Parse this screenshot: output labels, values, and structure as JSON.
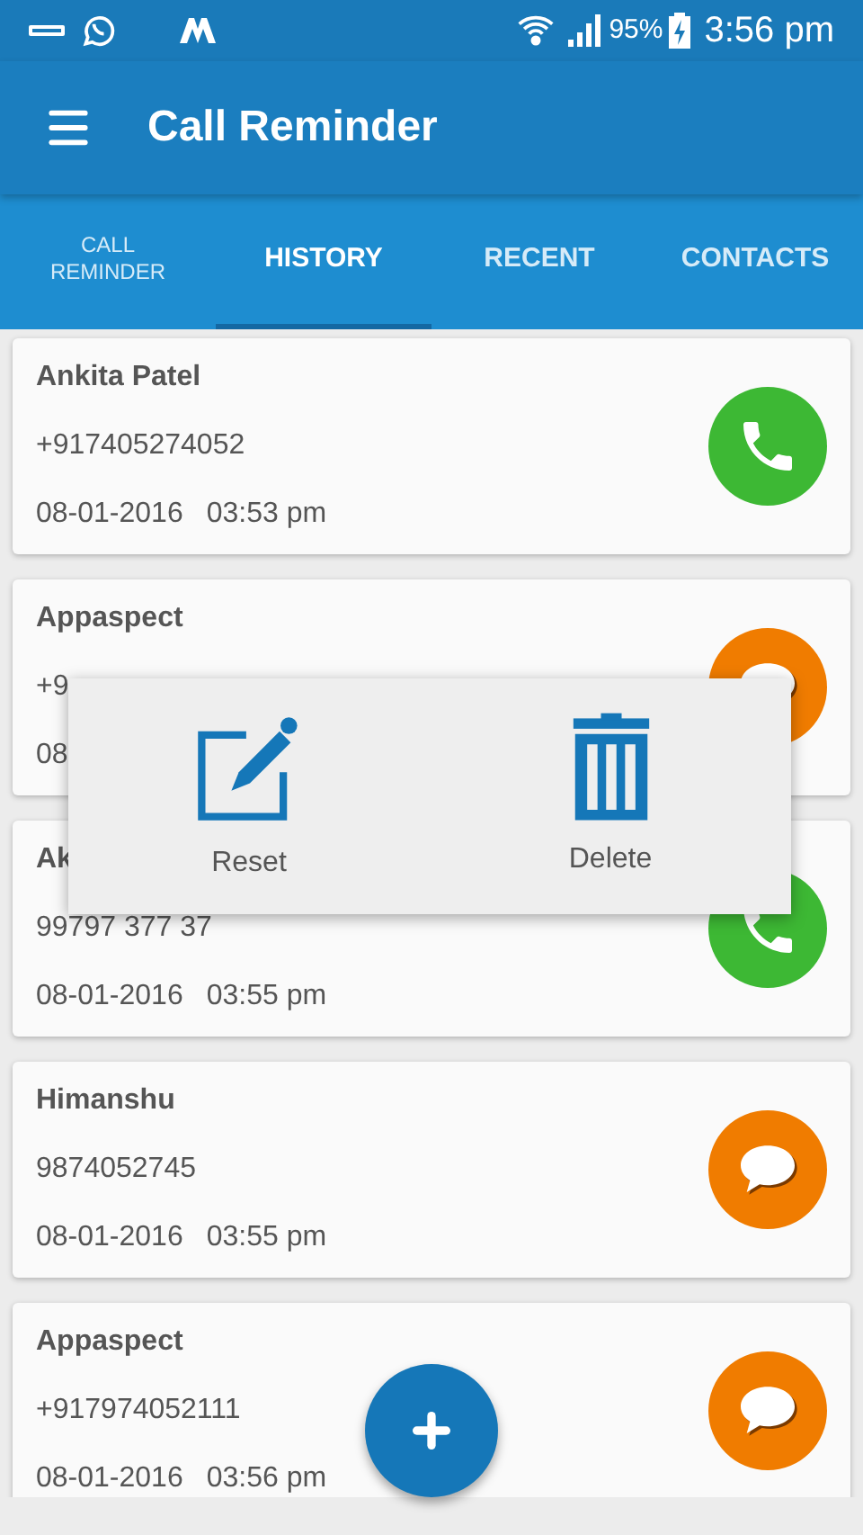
{
  "status_bar": {
    "battery": "95%",
    "time": "3:56 pm"
  },
  "app_bar": {
    "title": "Call Reminder"
  },
  "tabs": [
    {
      "label": "CALL\nREMINDER",
      "selected": false
    },
    {
      "label": "HISTORY",
      "selected": true
    },
    {
      "label": "RECENT",
      "selected": false
    },
    {
      "label": "CONTACTS",
      "selected": false
    }
  ],
  "entries": [
    {
      "name": "Ankita Patel",
      "phone": "+917405274052",
      "date": "08-01-2016",
      "time": "03:53 pm",
      "kind": "call"
    },
    {
      "name": "Appaspect",
      "phone": "+9",
      "date": "08",
      "kind": "message"
    },
    {
      "name": "Ak",
      "phone": "99797 377 37",
      "date": "08-01-2016",
      "time": "03:55 pm",
      "kind": "call"
    },
    {
      "name": "Himanshu",
      "phone": "9874052745",
      "date": "08-01-2016",
      "time": "03:55 pm",
      "kind": "message"
    },
    {
      "name": "Appaspect",
      "phone": "+917974052111",
      "date": "08-01-2016",
      "time": "03:56 pm",
      "kind": "message"
    }
  ],
  "popup_menu": [
    {
      "label": "Reset",
      "kind": "edit"
    },
    {
      "label": "Delete",
      "kind": "delete"
    }
  ]
}
